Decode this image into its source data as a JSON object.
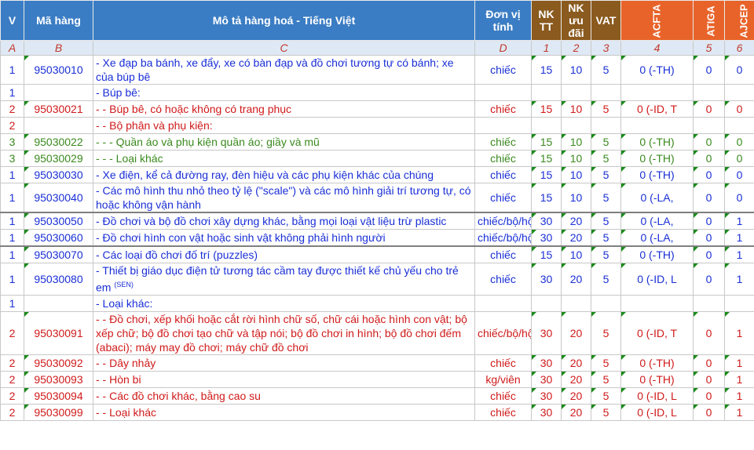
{
  "header": {
    "col_v": "V",
    "col_code": "Mã hàng",
    "col_desc": "Mô tả hàng hoá - Tiếng Việt",
    "col_unit": "Đơn vị tính",
    "col_nktt": "NK TT",
    "col_nkud": "NK ưu đãi",
    "col_vat": "VAT",
    "col_acfta": "ACFTA",
    "col_atiga": "ATIGA",
    "col_ajcep": "AJCEP"
  },
  "letters": [
    "A",
    "B",
    "C",
    "D",
    "1",
    "2",
    "3",
    "4",
    "5",
    "6"
  ],
  "rows": [
    {
      "lvl": "1",
      "code": "95030010",
      "desc": "- Xe đạp ba bánh, xe đẩy, xe có bàn đạp và đồ chơi tương tự có bánh; xe của búp bê",
      "unit": "chiếc",
      "nktt": "15",
      "nkud": "10",
      "vat": "5",
      "acfta": "0 (-TH)",
      "atiga": "0",
      "ajcep": "0"
    },
    {
      "lvl": "1",
      "code": "",
      "desc": "- Búp bê:",
      "unit": "",
      "nktt": "",
      "nkud": "",
      "vat": "",
      "acfta": "",
      "atiga": "",
      "ajcep": ""
    },
    {
      "lvl": "2",
      "code": "95030021",
      "desc": "- - Búp bê, có hoặc không có trang phục",
      "unit": "chiếc",
      "nktt": "15",
      "nkud": "10",
      "vat": "5",
      "acfta": "0 (-ID, T",
      "atiga": "0",
      "ajcep": "0"
    },
    {
      "lvl": "2",
      "code": "",
      "desc": "- - Bộ phận và phụ kiện:",
      "unit": "",
      "nktt": "",
      "nkud": "",
      "vat": "",
      "acfta": "",
      "atiga": "",
      "ajcep": ""
    },
    {
      "lvl": "3",
      "code": "95030022",
      "desc": "- - - Quần áo và phụ kiện quần áo; giầy và mũ",
      "unit": "chiếc",
      "nktt": "15",
      "nkud": "10",
      "vat": "5",
      "acfta": "0 (-TH)",
      "atiga": "0",
      "ajcep": "0"
    },
    {
      "lvl": "3",
      "code": "95030029",
      "desc": "- - - Loại khác",
      "unit": "chiếc",
      "nktt": "15",
      "nkud": "10",
      "vat": "5",
      "acfta": "0 (-TH)",
      "atiga": "0",
      "ajcep": "0"
    },
    {
      "lvl": "1",
      "code": "95030030",
      "desc": "- Xe điện, kể cả đường ray, đèn hiệu và các phụ kiện khác của chúng",
      "unit": "chiếc",
      "nktt": "15",
      "nkud": "10",
      "vat": "5",
      "acfta": "0 (-TH)",
      "atiga": "0",
      "ajcep": "0"
    },
    {
      "lvl": "1",
      "code": "95030040",
      "desc": "- Các mô hình thu nhỏ theo tỷ lệ (\"scale\") và các mô hình giải trí tương tự, có hoặc không vận hành",
      "unit": "chiếc",
      "nktt": "15",
      "nkud": "10",
      "vat": "5",
      "acfta": "0 (-LA,",
      "atiga": "0",
      "ajcep": "0"
    },
    {
      "lvl": "1",
      "code": "95030050",
      "desc": "- Đồ chơi và bộ đồ chơi xây dựng khác, bằng mọi loại vật liệu trừ plastic",
      "unit": "chiếc/bộ/hộp",
      "nktt": "30",
      "nkud": "20",
      "vat": "5",
      "acfta": "0 (-LA,",
      "atiga": "0",
      "ajcep": "1"
    },
    {
      "lvl": "1",
      "code": "95030060",
      "desc": "- Đồ chơi hình con vật hoặc sinh vật không phải hình người",
      "unit": "chiếc/bộ/hộp",
      "nktt": "30",
      "nkud": "20",
      "vat": "5",
      "acfta": "0 (-LA,",
      "atiga": "0",
      "ajcep": "1"
    },
    {
      "lvl": "1",
      "code": "95030070",
      "desc": "- Các loại đồ chơi đố trí (puzzles)",
      "unit": "chiếc",
      "nktt": "15",
      "nkud": "10",
      "vat": "5",
      "acfta": "0 (-TH)",
      "atiga": "0",
      "ajcep": "1"
    },
    {
      "lvl": "1",
      "code": "95030080",
      "desc": "- Thiết bị giáo dục điện tử tương tác cầm tay được thiết kế chủ yếu cho trẻ em",
      "sup": "(SEN)",
      "unit": "chiếc",
      "nktt": "30",
      "nkud": "20",
      "vat": "5",
      "acfta": "0 (-ID, L",
      "atiga": "0",
      "ajcep": "1"
    },
    {
      "lvl": "1",
      "code": "",
      "desc": "- Loại khác:",
      "unit": "",
      "nktt": "",
      "nkud": "",
      "vat": "",
      "acfta": "",
      "atiga": "",
      "ajcep": ""
    },
    {
      "lvl": "2",
      "code": "95030091",
      "desc": "- - Đồ chơi, xếp khối hoặc cắt rời hình chữ số, chữ cái hoặc hình con vật; bộ xếp chữ; bộ đồ chơi tạo chữ và tập nói; bộ đồ chơi in hình; bộ đồ chơi đếm (abaci); máy may đồ chơi; máy chữ đồ chơi",
      "unit": "chiếc/bộ/hộp",
      "nktt": "30",
      "nkud": "20",
      "vat": "5",
      "acfta": "0 (-ID, T",
      "atiga": "0",
      "ajcep": "1"
    },
    {
      "lvl": "2",
      "code": "95030092",
      "desc": "- - Dây nhảy",
      "unit": "chiếc",
      "nktt": "30",
      "nkud": "20",
      "vat": "5",
      "acfta": "0 (-TH)",
      "atiga": "0",
      "ajcep": "1"
    },
    {
      "lvl": "2",
      "code": "95030093",
      "desc": "- - Hòn bi",
      "unit": "kg/viên",
      "nktt": "30",
      "nkud": "20",
      "vat": "5",
      "acfta": "0 (-TH)",
      "atiga": "0",
      "ajcep": "1"
    },
    {
      "lvl": "2",
      "code": "95030094",
      "desc": "- - Các đồ chơi khác, bằng cao su",
      "unit": "chiếc",
      "nktt": "30",
      "nkud": "20",
      "vat": "5",
      "acfta": "0 (-ID, L",
      "atiga": "0",
      "ajcep": "1"
    },
    {
      "lvl": "2",
      "code": "95030099",
      "desc": "- - Loại khác",
      "unit": "chiếc",
      "nktt": "30",
      "nkud": "20",
      "vat": "5",
      "acfta": "0 (-ID, L",
      "atiga": "0",
      "ajcep": "1"
    }
  ]
}
